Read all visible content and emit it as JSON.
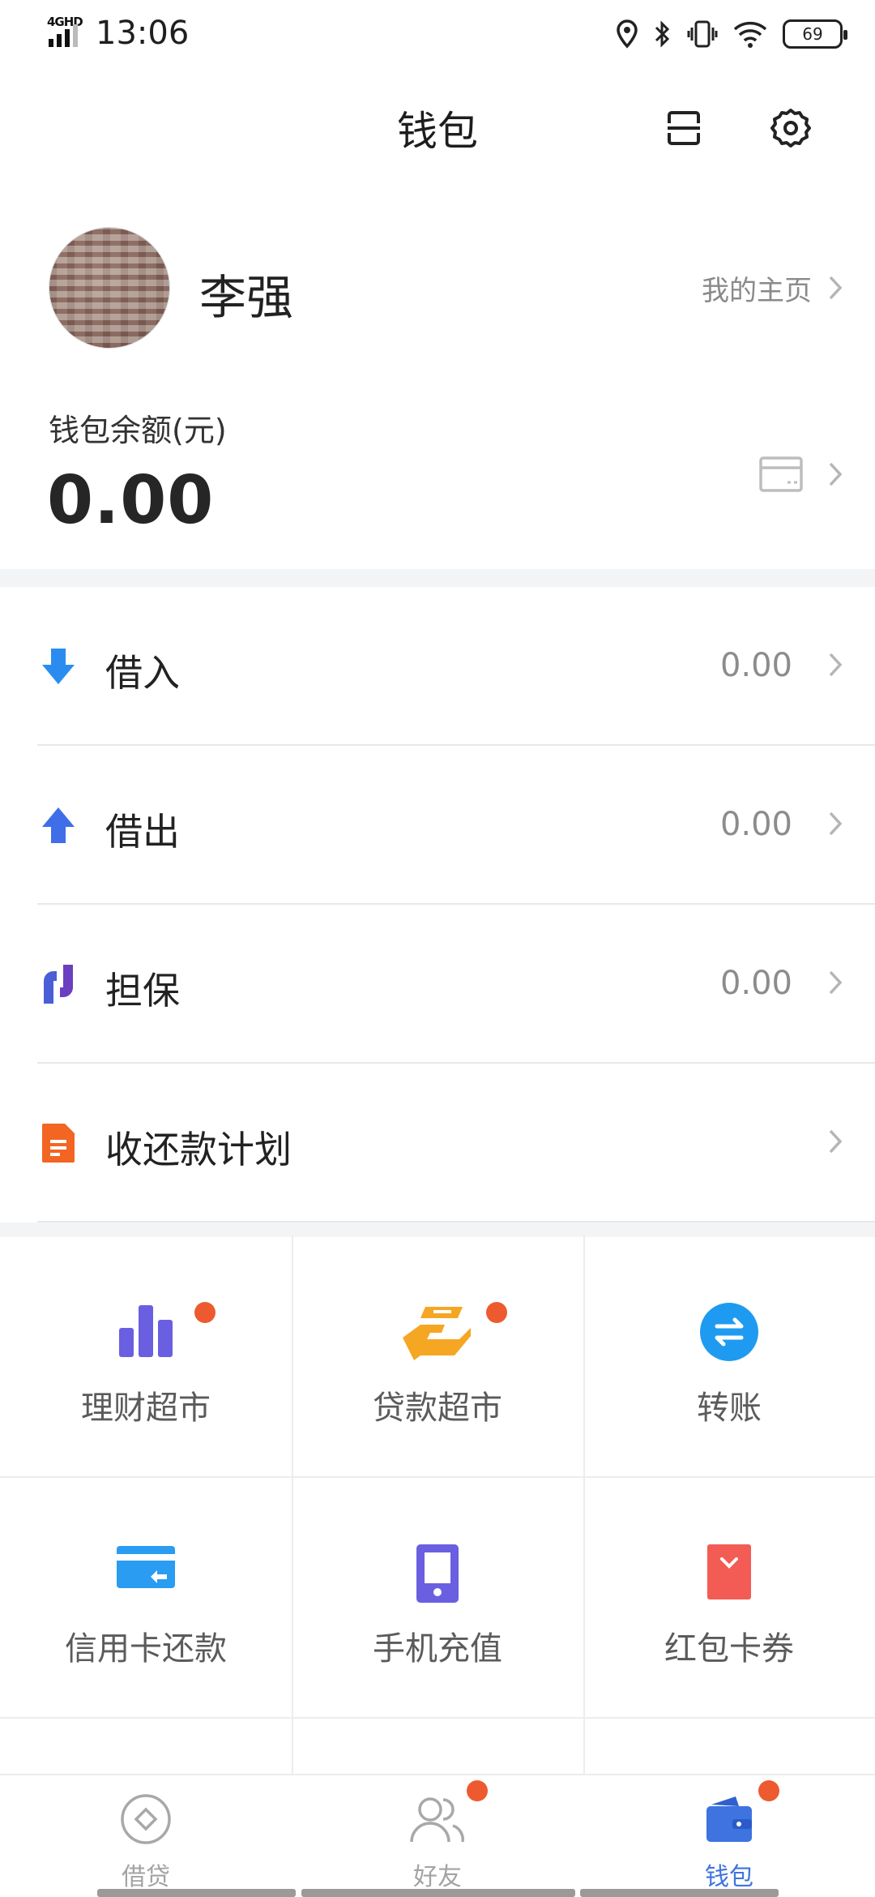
{
  "status_bar": {
    "network": "4GHD",
    "time": "13:06",
    "battery": "69",
    "icons": [
      "location-icon",
      "bluetooth-icon",
      "vibrate-icon",
      "wifi-icon",
      "battery-icon"
    ]
  },
  "header": {
    "title": "钱包",
    "icons": [
      "scan-icon",
      "settings-icon"
    ]
  },
  "profile": {
    "name": "李强",
    "homepage_link": "我的主页"
  },
  "balance": {
    "label": "钱包余额(元)",
    "value": "0.00"
  },
  "list": [
    {
      "label": "借入",
      "value": "0.00",
      "icon": "arrow-down-icon",
      "color": "#2b8cf0"
    },
    {
      "label": "借出",
      "value": "0.00",
      "icon": "arrow-up-icon",
      "color": "#3f6ee8"
    },
    {
      "label": "担保",
      "value": "0.00",
      "icon": "guarantee-icon",
      "color": "#5a48c8"
    },
    {
      "label": "收还款计划",
      "value": "",
      "icon": "document-icon",
      "color": "#f26522"
    }
  ],
  "grid": [
    {
      "label": "理财超市",
      "icon": "bar-chart-icon",
      "badge": true,
      "color": "#6a5fe0"
    },
    {
      "label": "贷款超市",
      "icon": "hand-money-icon",
      "badge": true,
      "color": "#f5a623"
    },
    {
      "label": "转账",
      "icon": "transfer-icon",
      "badge": false,
      "color": "#1e9bf0"
    },
    {
      "label": "信用卡还款",
      "icon": "credit-card-icon",
      "badge": false,
      "color": "#2a9cf2"
    },
    {
      "label": "手机充值",
      "icon": "phone-icon",
      "badge": false,
      "color": "#6a5fe0"
    },
    {
      "label": "红包卡券",
      "icon": "red-envelope-icon",
      "badge": false,
      "color": "#f25c54"
    }
  ],
  "bottom_nav": [
    {
      "label": "借贷",
      "icon": "loan-icon",
      "active": false,
      "badge": false
    },
    {
      "label": "好友",
      "icon": "friends-icon",
      "active": false,
      "badge": true
    },
    {
      "label": "钱包",
      "icon": "wallet-icon",
      "active": true,
      "badge": true
    }
  ],
  "colors": {
    "accent": "#3e73e0",
    "badge": "#ee5a2f",
    "separator": "#f3f4f6"
  }
}
